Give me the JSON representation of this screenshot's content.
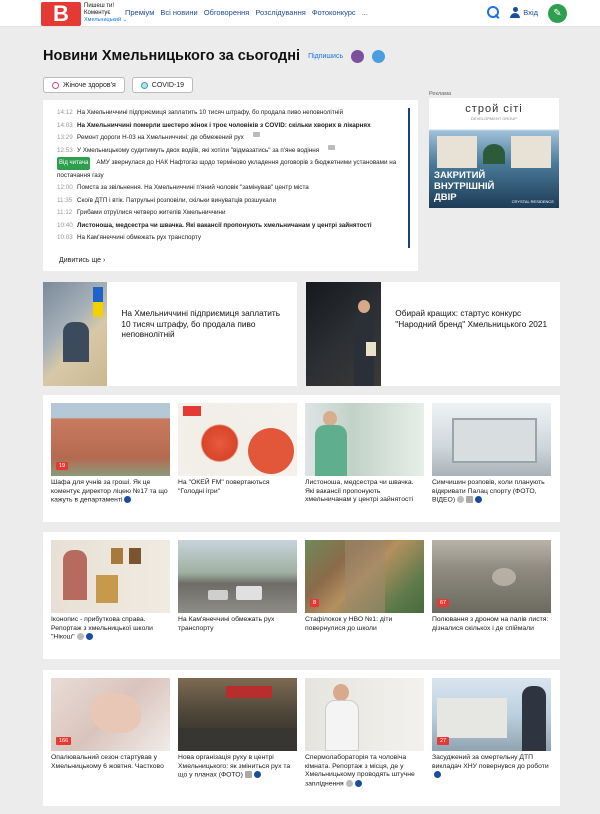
{
  "header": {
    "logo_letter": "В",
    "tagline1": "Пишеш ти!",
    "tagline2": "Коментує",
    "city": "Хмельницький ⌄",
    "nav": [
      "Преміум",
      "Всі новини",
      "Обговорення",
      "Розслідування",
      "Фотоконкурс",
      "..."
    ],
    "login": "Вхід"
  },
  "page": {
    "title": "Новини Хмельницького за сьогодні",
    "subscribe": "Підпишись",
    "tags": [
      "Жіноче здоров'я",
      "COVID-19"
    ]
  },
  "feed": {
    "items": [
      {
        "time": "14:12",
        "text": "На Хмельниччині підприємиця заплатить 10 тисяч штрафу, бо продала пиво неповнолітній",
        "bold": false
      },
      {
        "time": "14:03",
        "text": "На Хмельниччині померли шестеро жінок і троє чоловіків з COVID: скільки хворих в лікарнях",
        "bold": true
      },
      {
        "time": "13:29",
        "text": "Ремонт дороги Н-03 на Хмельниччині: де обмежений рух",
        "bold": false
      },
      {
        "time": "12:53",
        "text": "У Хмельницькому судитимуть двох водіїв, які хотіли \"відмазатись\" за п'яне водіння",
        "bold": false
      },
      {
        "time": "Від читача",
        "text": "АМУ звернулася до НАК Нафтогаз щодо терміново укладення договорів з бюджетними установами на",
        "bold": false
      },
      {
        "time": "",
        "text": "постачання газу",
        "bold": false
      },
      {
        "time": "12:00",
        "text": "Помста за звільнення. На Хмельниччині п'яний чоловік \"замінував\" центр міста",
        "bold": false
      },
      {
        "time": "11:35",
        "text": "Скоїв ДТП і втік. Патрульні розповіли, скільки винуватців розшукали",
        "bold": false
      },
      {
        "time": "11:12",
        "text": "Грибами отруїлися четверо жителів Хмельниччини",
        "bold": false
      },
      {
        "time": "10:40",
        "text": "Листоноша, медсестра чи швачка. Які вакансії пропонують хмельничанам у центрі зайнятості",
        "bold": true
      },
      {
        "time": "10:03",
        "text": "На Кам'янеччині обмежать рух транспорту",
        "bold": false
      }
    ],
    "more": "Дивитись ще"
  },
  "ad": {
    "label": "Реклама",
    "brand": "строй сіті",
    "brand_sub": "DEVELOPMENT GROUP",
    "line1": "ЗАКРИТИЙ",
    "line2": "ВНУТРІШНІЙ",
    "line3": "ДВІР",
    "logo": "CRYSTAL RESIDENCE"
  },
  "featured": [
    {
      "title": "На Хмельниччині підприємиця заплатить 10 тисяч штрафу, бо продала пиво неповнолітній"
    },
    {
      "title": "Обирай кращих: стартус конкурс \"Народний бренд\" Хмельницького 2021"
    }
  ],
  "grid1": [
    {
      "count": "19",
      "caption": "Шафа для учнів за гроші. Як це коментує директор ліцею №17 та що кажуть в департаменті"
    },
    {
      "count": "",
      "caption": "На \"ОКЕЙ FM\" повертаються \"Голодні ігри\""
    },
    {
      "count": "",
      "caption": "Листоноша, медсестра чи швачка. Які вакансії пропонують хмельничанам у центрі зайнятості"
    },
    {
      "count": "",
      "caption": "Симчишин розповів, коли планують відкривати Палац спорту (ФОТО, ВІДЕО)"
    }
  ],
  "grid2": [
    {
      "count": "",
      "caption": "Іконопис - прибуткова справа. Репортаж з хмельницької школи \"Нікош\""
    },
    {
      "count": "",
      "caption": "На Кам'янеччині обмежать рух транспорту"
    },
    {
      "count": "8",
      "caption": "Стафілокок у НВО №1: діти повернулися до школи"
    },
    {
      "count": "67",
      "caption": "Полювання з дроном на палів листя: дізналися скількох і де спіймали"
    }
  ],
  "grid3": [
    {
      "count": "166",
      "caption": "Опалювальний сезон стартував у Хмельницькому 6 жовтня. Частково"
    },
    {
      "count": "",
      "caption": "Нова організація руху в центрі Хмельницького: як зміниться рух та що у планах (ФОТО)"
    },
    {
      "count": "",
      "caption": "Спермолабораторія та чоловіча кімната. Репортаж з місця, де у Хмельницькому проводять штучне запліднення"
    },
    {
      "count": "27",
      "caption": "Засуджений за смертельну ДТП викладач ХНУ повернувся до роботи"
    }
  ],
  "colors": {
    "brand": "#e53935",
    "link": "#1a4d9e",
    "accent": "#1a73e8"
  }
}
